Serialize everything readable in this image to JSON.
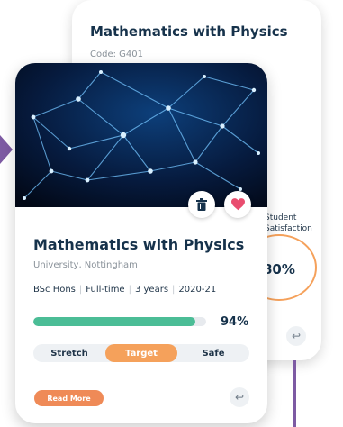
{
  "back_card": {
    "title": "Mathematics with Physics",
    "code": "Code: G401",
    "satisfaction_label": "Student Satisfaction",
    "satisfaction_value": "80%"
  },
  "front_card": {
    "title": "Mathematics with Physics",
    "university": "University, Nottingham",
    "meta": [
      "BSc Hons",
      "Full-time",
      "3 years",
      "2020-21"
    ],
    "match_label": "94%",
    "match_fraction": 0.94,
    "segments": [
      "Stretch",
      "Target",
      "Safe"
    ],
    "active_segment": "Target",
    "read_more": "Read More"
  },
  "icons": {
    "trash": "trash-icon",
    "heart": "heart-icon",
    "return": "return-arrow-icon"
  },
  "colors": {
    "navy": "#16324b",
    "orange": "#f5a15b",
    "green": "#4bbd96",
    "heart": "#e94d6f",
    "connector": "#7d5aa3"
  }
}
